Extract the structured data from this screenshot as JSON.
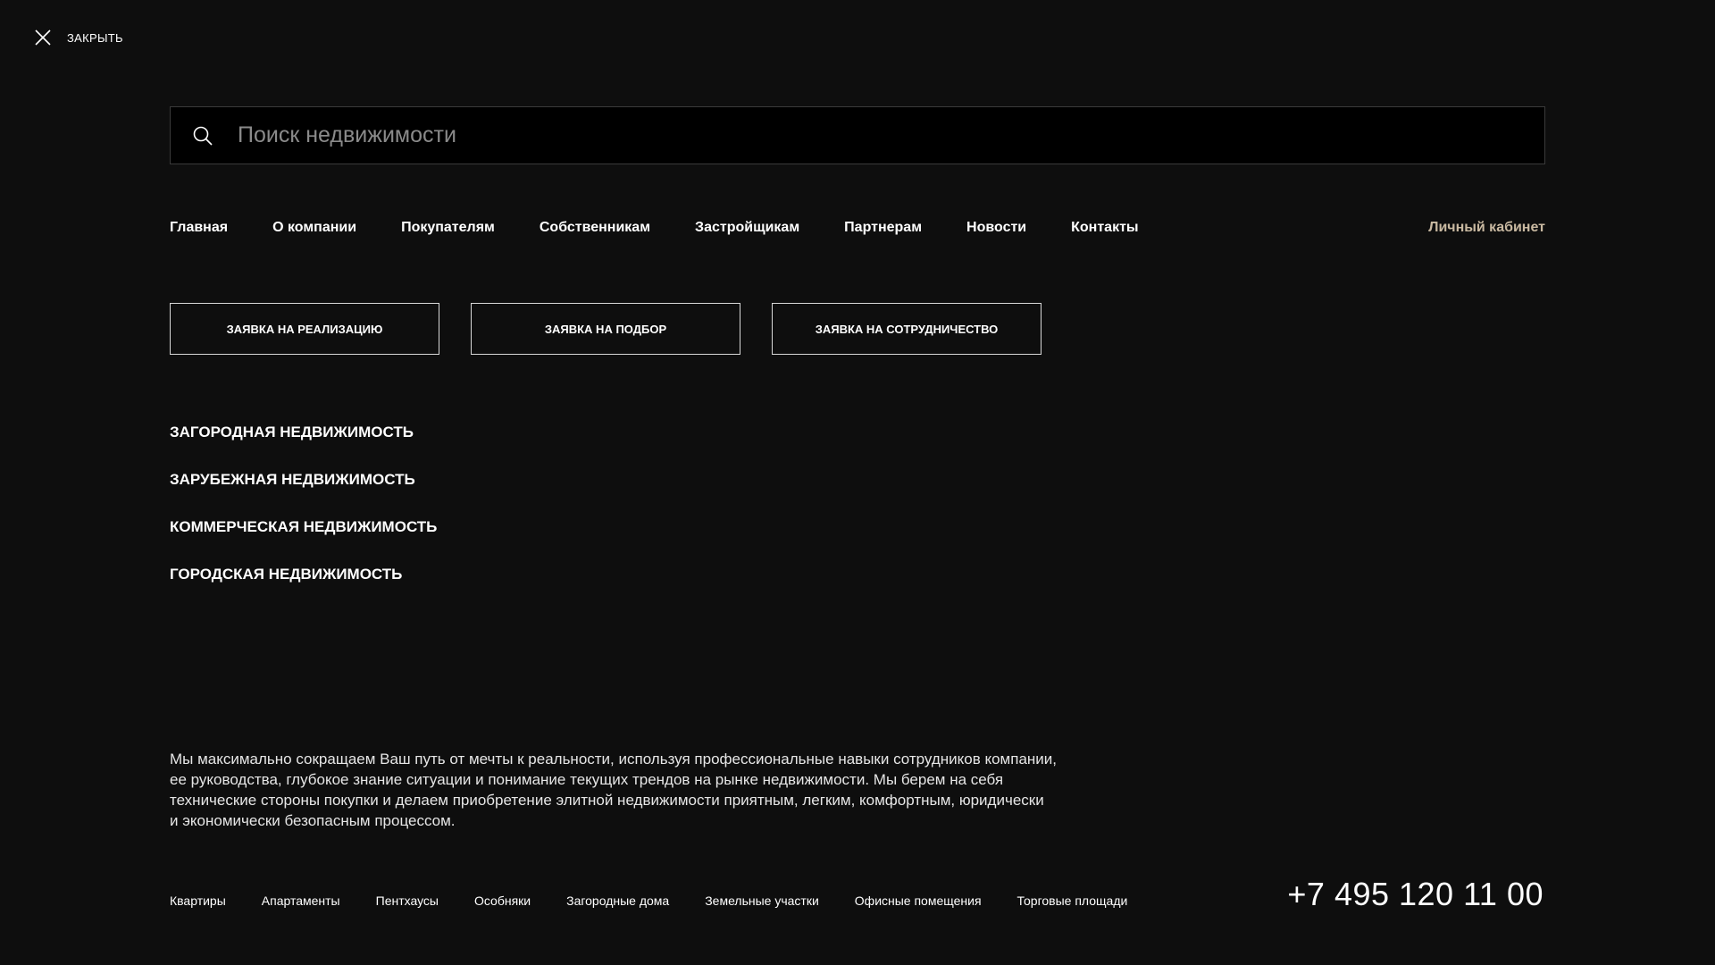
{
  "close": {
    "label": "ЗАКРЫТЬ",
    "icon": "close-icon"
  },
  "search": {
    "placeholder": "Поиск недвижимости",
    "value": "",
    "icon": "search-icon"
  },
  "nav": {
    "items": [
      {
        "label": "Главная"
      },
      {
        "label": "О компании"
      },
      {
        "label": "Покупателям"
      },
      {
        "label": "Собственникам"
      },
      {
        "label": "Застройщикам"
      },
      {
        "label": "Партнерам"
      },
      {
        "label": "Новости"
      },
      {
        "label": "Контакты"
      }
    ],
    "cabinet": "Личный кабинет"
  },
  "actions": [
    {
      "label": "ЗАЯВКА НА РЕАЛИЗАЦИЮ"
    },
    {
      "label": "ЗАЯВКА НА ПОДБОР"
    },
    {
      "label": "ЗАЯВКА НА СОТРУДНИЧЕСТВО"
    }
  ],
  "categories": [
    {
      "label": "ЗАГОРОДНАЯ НЕДВИЖИМОСТЬ"
    },
    {
      "label": "ЗАРУБЕЖНАЯ НЕДВИЖИМОСТЬ"
    },
    {
      "label": "КОММЕРЧЕСКАЯ НЕДВИЖИМОСТЬ"
    },
    {
      "label": "ГОРОДСКАЯ НЕДВИЖИМОСТЬ"
    }
  ],
  "about": {
    "lines": [
      "Мы максимально сокращаем Ваш путь от мечты к реальности, используя профессиональные навыки сотрудников компании,",
      "ее руководства, глубокое знание ситуации и понимание текущих трендов на рынке недвижимости. Мы берем на себя",
      "технические стороны покупки и делаем приобретение элитной недвижимости приятным, легким, комфортным, юридически",
      "и экономически безопасным процессом."
    ]
  },
  "footer": {
    "links": [
      {
        "label": "Квартиры"
      },
      {
        "label": "Апартаменты"
      },
      {
        "label": "Пентхаусы"
      },
      {
        "label": "Особняки"
      },
      {
        "label": "Загородные дома"
      },
      {
        "label": "Земельные участки"
      },
      {
        "label": "Офисные помещения"
      },
      {
        "label": "Торговые площади"
      }
    ],
    "phone": "+7 495 120 11 00"
  },
  "colors": {
    "background": "#0e0e0e",
    "search_background": "#000000",
    "accent": "#c9b9a1",
    "text": "#ffffff"
  }
}
